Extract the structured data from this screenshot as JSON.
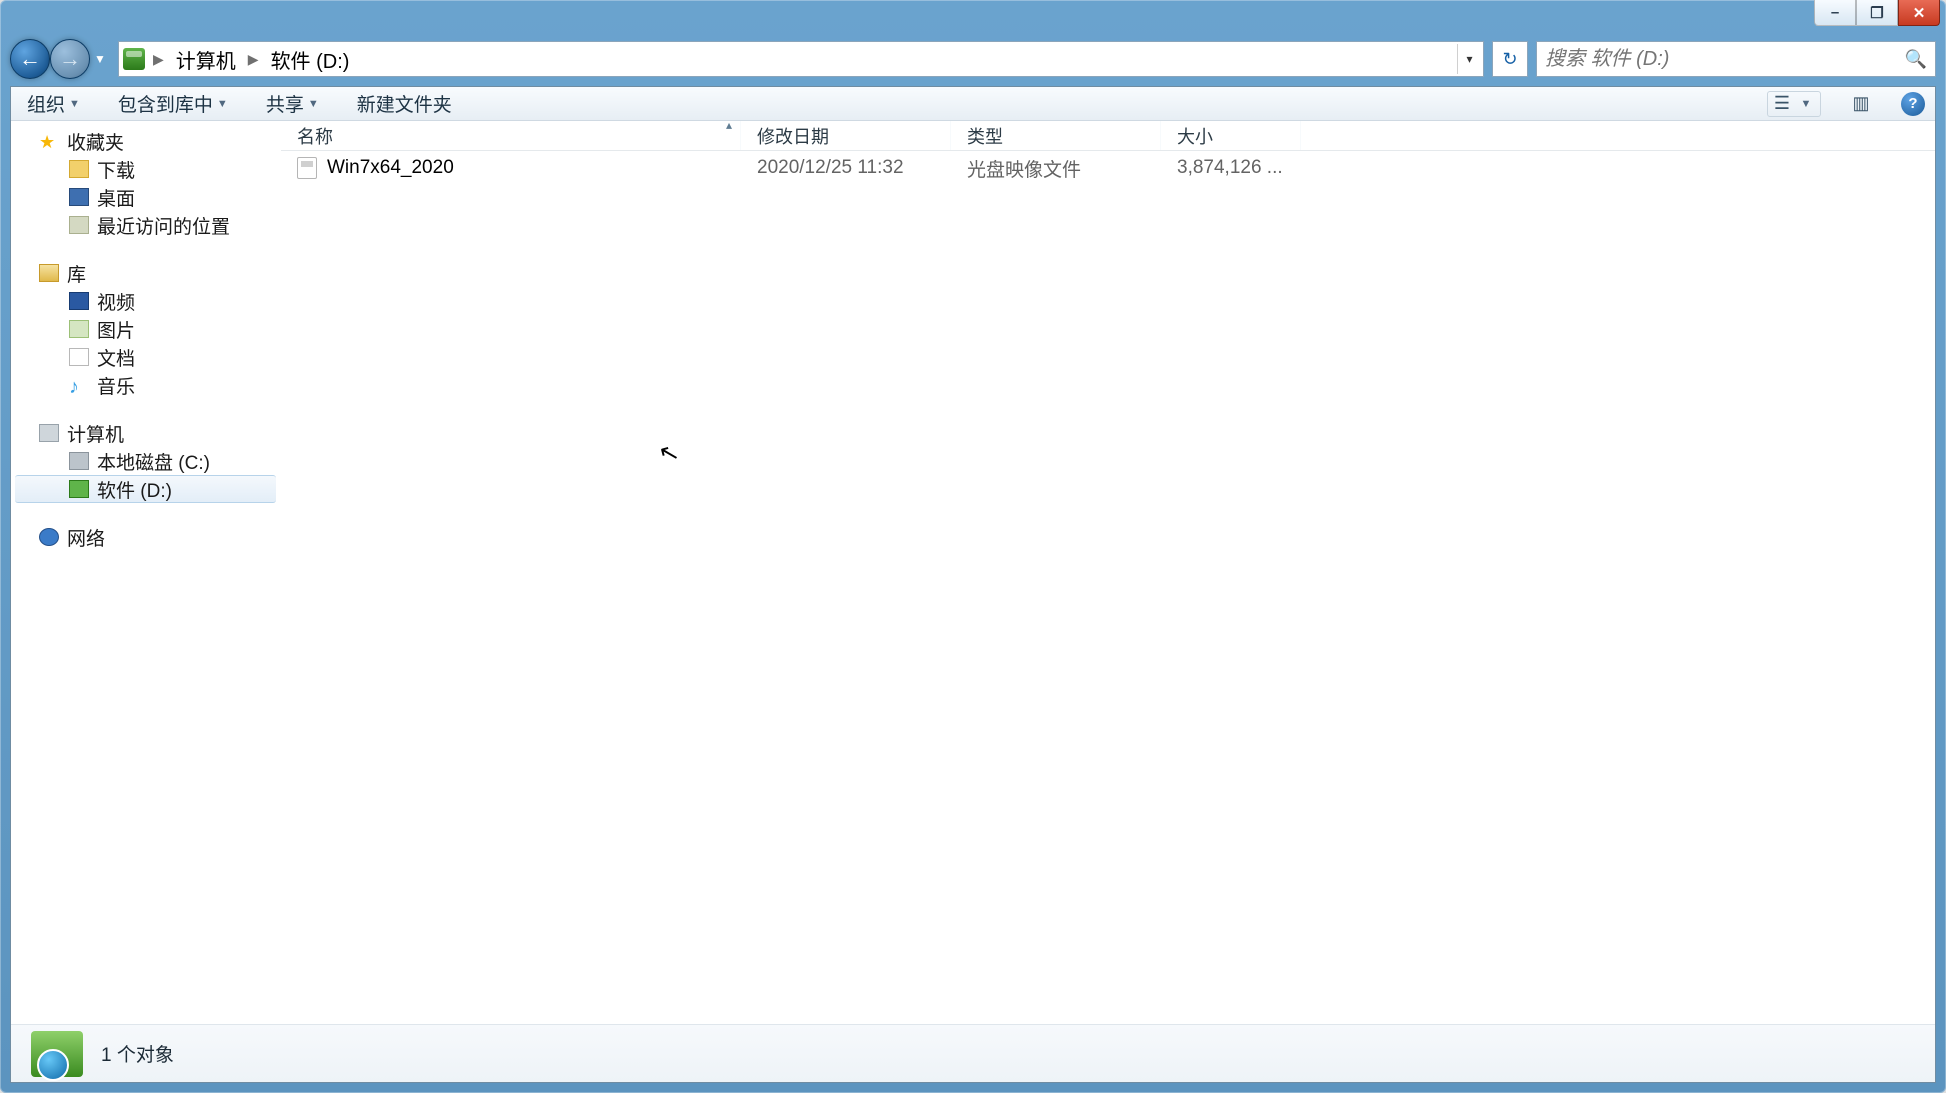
{
  "window_controls": {
    "minimize": "–",
    "maximize": "❐",
    "close": "✕"
  },
  "address": {
    "segments": [
      "计算机",
      "软件 (D:)"
    ]
  },
  "search": {
    "placeholder": "搜索 软件 (D:)"
  },
  "toolbar": {
    "organize": "组织",
    "include": "包含到库中",
    "share": "共享",
    "newfolder": "新建文件夹"
  },
  "navpane": {
    "favorites": {
      "label": "收藏夹",
      "items": [
        {
          "id": "downloads",
          "label": "下载"
        },
        {
          "id": "desktop",
          "label": "桌面"
        },
        {
          "id": "recent",
          "label": "最近访问的位置"
        }
      ]
    },
    "libraries": {
      "label": "库",
      "items": [
        {
          "id": "videos",
          "label": "视频"
        },
        {
          "id": "pictures",
          "label": "图片"
        },
        {
          "id": "documents",
          "label": "文档"
        },
        {
          "id": "music",
          "label": "音乐"
        }
      ]
    },
    "computer": {
      "label": "计算机",
      "items": [
        {
          "id": "drive-c",
          "label": "本地磁盘 (C:)"
        },
        {
          "id": "drive-d",
          "label": "软件 (D:)",
          "selected": true
        }
      ]
    },
    "network": {
      "label": "网络"
    }
  },
  "columns": {
    "name": "名称",
    "date": "修改日期",
    "type": "类型",
    "size": "大小"
  },
  "files": [
    {
      "name": "Win7x64_2020",
      "date": "2020/12/25 11:32",
      "type": "光盘映像文件",
      "size": "3,874,126 ..."
    }
  ],
  "status": {
    "count_text": "1 个对象"
  }
}
